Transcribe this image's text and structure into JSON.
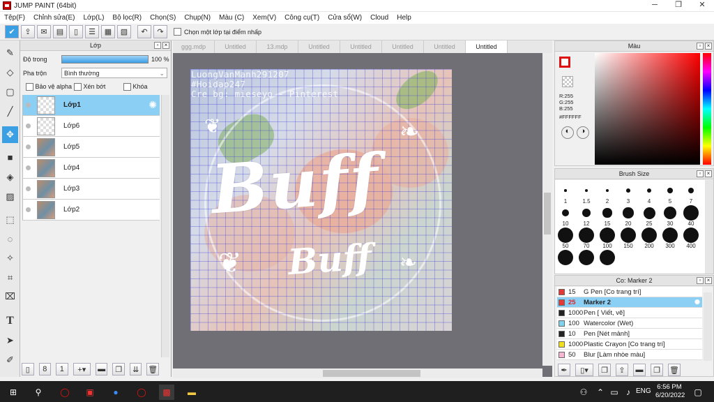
{
  "app": {
    "title": "JUMP PAINT (64bit)"
  },
  "window_controls": {
    "minimize": "─",
    "maximize": "❐",
    "close": "✕"
  },
  "menu": [
    "Tệp(F)",
    "Chỉnh sửa(E)",
    "Lớp(L)",
    "Bộ lọc(R)",
    "Chọn(S)",
    "Chụp(N)",
    "Màu (C)",
    "Xem(V)",
    "Công cụ(T)",
    "Cửa sổ(W)",
    "Cloud",
    "Help"
  ],
  "toolbar": {
    "select_layer_label": "Chọn một lớp tại điểm nhấp"
  },
  "layer_panel": {
    "title": "Lớp",
    "opacity_label": "Độ trong",
    "opacity_value": "100 %",
    "opacity": 1.0,
    "blend_label": "Pha trộn",
    "blend_value": "Bình thường",
    "protect_alpha": "Bảo vệ alpha",
    "clipping": "Xén bớt",
    "lock": "Khóa",
    "layers": [
      "Lớp1",
      "Lớp6",
      "Lớp5",
      "Lớp4",
      "Lớp3",
      "Lớp2"
    ]
  },
  "tabs": [
    "ggg.mdp",
    "Untitled",
    "13.mdp",
    "Untitled",
    "Untitled",
    "Untitled",
    "Untitled",
    "Untitled"
  ],
  "canvas": {
    "watermark": [
      "LuongVanManh291207",
      "#Hoidap247",
      "Cre bg: mieseyo - Pinterest"
    ],
    "big_text": "Buff",
    "small_text": "Buff"
  },
  "color_panel": {
    "title": "Màu",
    "r": "R:255",
    "g": "G:255",
    "b": "B:255",
    "hex": "#FFFFFF"
  },
  "brush_panel": {
    "title": "Brush Size",
    "sizes": [
      "1",
      "1.5",
      "2",
      "3",
      "4",
      "5",
      "7",
      "10",
      "12",
      "15",
      "20",
      "25",
      "30",
      "40",
      "50",
      "70",
      "100",
      "150",
      "200",
      "300",
      "400"
    ]
  },
  "pen_panel": {
    "title": "Co: Marker 2",
    "pens": [
      {
        "size": "15",
        "name": "G Pen [Co trang trí]",
        "color": "#e53935"
      },
      {
        "size": "25",
        "name": "Marker 2",
        "color": "#e53935"
      },
      {
        "size": "1000",
        "name": "Pen [ Viết, vẽ]",
        "color": "#222222"
      },
      {
        "size": "100",
        "name": "Watercolor (Wet)",
        "color": "#7fd3ef"
      },
      {
        "size": "10",
        "name": "Pen [Nét mảnh]",
        "color": "#222222"
      },
      {
        "size": "1000",
        "name": "Plastic Crayon [Co trang trí]",
        "color": "#f2df1c"
      },
      {
        "size": "50",
        "name": "Blur [Làm nhòe màu]",
        "color": "#f5b7d1"
      }
    ]
  },
  "taskbar": {
    "time": "6:56 PM",
    "date": "6/20/2022",
    "lang": "ENG"
  }
}
